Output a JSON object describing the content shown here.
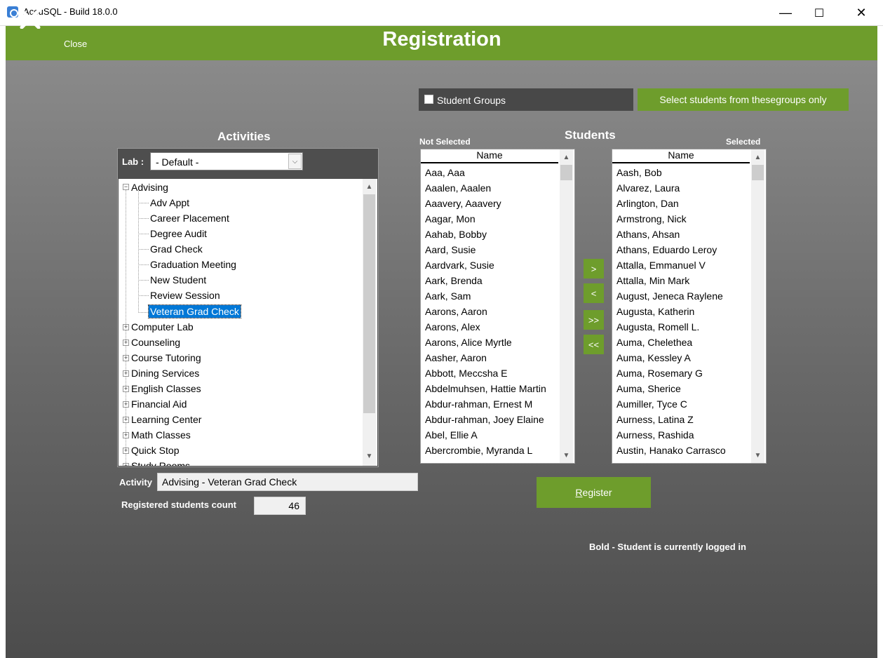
{
  "window": {
    "title": "AccuSQL - Build 18.0.0",
    "minimize": "—",
    "maximize": "☐",
    "close": "✕"
  },
  "header": {
    "close_label": "Close",
    "title": "Registration"
  },
  "student_groups": {
    "checkbox_label": "Student Groups",
    "checked": false,
    "select_button": "Select students from these groups only"
  },
  "activities": {
    "title": "Activities",
    "lab_label": "Lab :",
    "lab_value": "- Default -",
    "tree": [
      {
        "label": "Advising",
        "expanded": true,
        "children": [
          "Adv Appt",
          "Career Placement",
          "Degree Audit",
          "Grad Check",
          "Graduation Meeting",
          "New Student",
          "Review Session",
          "Veteran Grad Check"
        ],
        "selected_child": "Veteran Grad Check"
      },
      {
        "label": "Computer Lab",
        "expanded": false
      },
      {
        "label": "Counseling",
        "expanded": false
      },
      {
        "label": "Course Tutoring",
        "expanded": false
      },
      {
        "label": "Dining Services",
        "expanded": false
      },
      {
        "label": "English Classes",
        "expanded": false
      },
      {
        "label": "Financial Aid",
        "expanded": false
      },
      {
        "label": "Learning Center",
        "expanded": false
      },
      {
        "label": "Math Classes",
        "expanded": false
      },
      {
        "label": "Quick Stop",
        "expanded": false
      },
      {
        "label": "Study Rooms",
        "expanded": false
      }
    ],
    "activity_label": "Activity",
    "activity_value": "Advising - Veteran Grad Check",
    "count_label": "Registered students count",
    "count_value": "46"
  },
  "students": {
    "title": "Students",
    "not_selected_label": "Not Selected",
    "selected_label": "Selected",
    "column_header": "Name",
    "not_selected": [
      "Aaa, Aaa",
      "Aaalen, Aaalen",
      "Aaavery, Aaavery",
      "Aagar, Mon",
      "Aahab, Bobby",
      "Aard, Susie",
      "Aardvark, Susie",
      "Aark, Brenda",
      "Aark, Sam",
      "Aarons, Aaron",
      "Aarons, Alex",
      "Aarons, Alice Myrtle",
      "Aasher, Aaron",
      "Abbott, Meccsha E",
      "Abdelmuhsen, Hattie Martin",
      "Abdur-rahman, Ernest M",
      "Abdur-rahman, Joey Elaine",
      "Abel, Ellie A",
      "Abercrombie, Myranda L"
    ],
    "selected": [
      "Aash, Bob",
      "Alvarez, Laura",
      "Arlington, Dan",
      "Armstrong, Nick",
      "Athans, Ahsan",
      "Athans, Eduardo Leroy",
      "Attalla, Emmanuel V",
      "Attalla, Min Mark",
      "August, Jeneca Raylene",
      "Augusta, Katherin",
      "Augusta, Romell L.",
      "Auma, Chelethea",
      "Auma, Kessley A",
      "Auma, Rosemary G",
      "Auma, Sherice",
      "Aumiller, Tyce C",
      "Aurness, Latina Z",
      "Aurness, Rashida",
      "Austin, Hanako Carrasco"
    ],
    "move_buttons": {
      "add": ">",
      "remove": "<",
      "add_all": ">>",
      "remove_all": "<<"
    }
  },
  "register_button": "Register",
  "legend_note": "Bold - Student is currently logged in",
  "colors": {
    "accent": "#6e9d2c",
    "selection": "#0078d7",
    "dark_panel": "#484848"
  }
}
